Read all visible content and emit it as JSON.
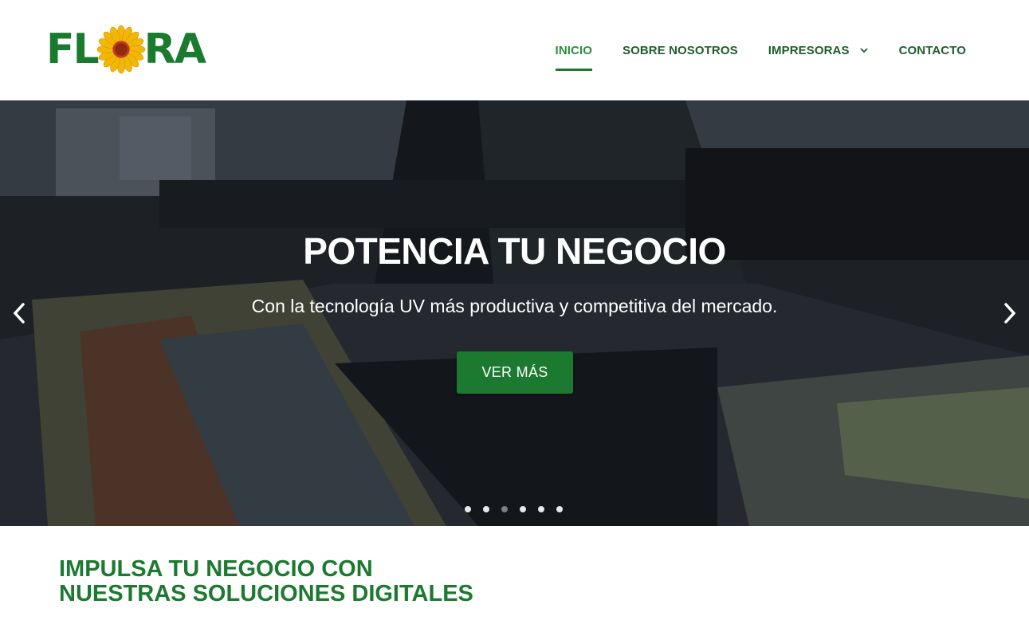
{
  "brand": {
    "name": "FLORA",
    "accent": "#1b7a2f",
    "flower_color": "#f2b705"
  },
  "nav": {
    "items": [
      {
        "label": "INICIO",
        "active": true
      },
      {
        "label": "SOBRE NOSOTROS",
        "active": false
      },
      {
        "label": "IMPRESORAS",
        "active": false,
        "has_dropdown": true
      },
      {
        "label": "CONTACTO",
        "active": false
      }
    ]
  },
  "hero": {
    "title": "POTENCIA TU NEGOCIO",
    "subtitle": "Con la tecnología UV más productiva y competitiva del mercado.",
    "button": "VER MÁS",
    "slides_count": 6,
    "active_slide": 3,
    "prev_icon": "chevron-left-icon",
    "next_icon": "chevron-right-icon"
  },
  "section": {
    "title_line1": "IMPULSA TU NEGOCIO CON",
    "title_line2": "NUESTRAS SOLUCIONES DIGITALES"
  }
}
